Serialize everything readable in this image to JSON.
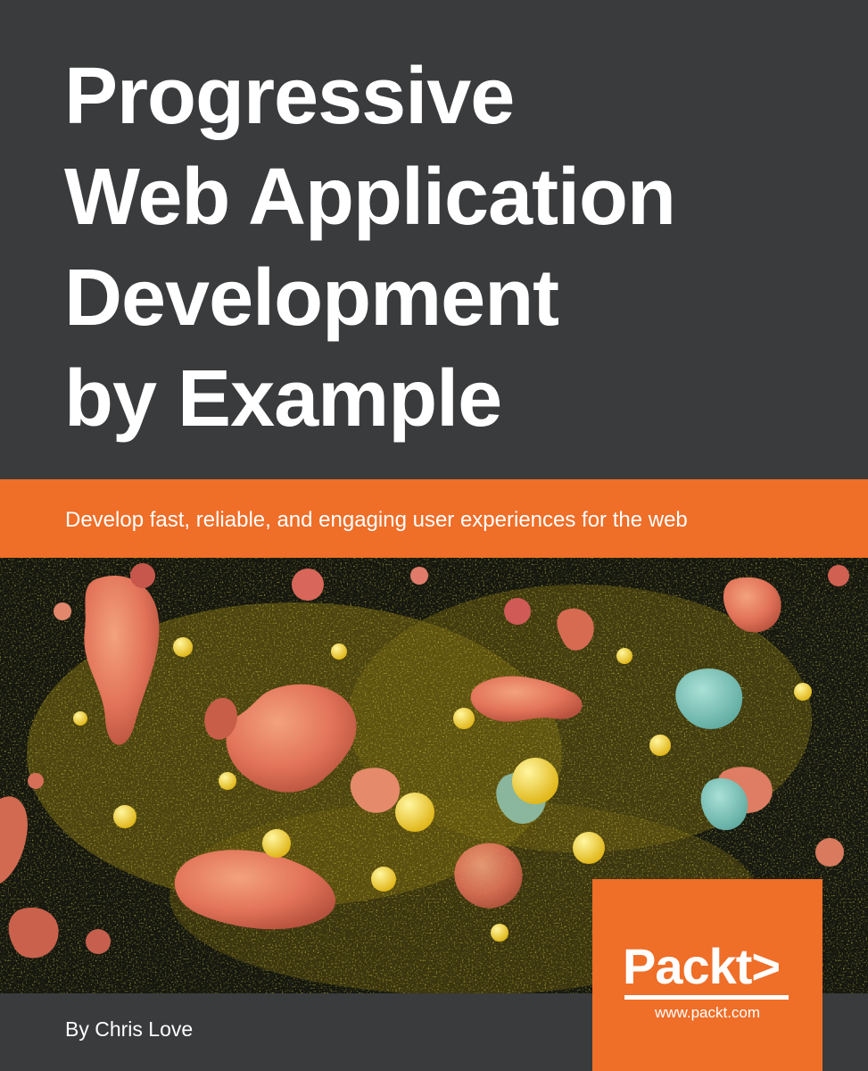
{
  "cover": {
    "title_lines": [
      "Progressive",
      "Web Application",
      "Development",
      "by Example"
    ],
    "subtitle": "Develop fast, reliable, and engaging user experiences for the web",
    "author": "By Chris Love",
    "publisher": {
      "logo_text": "Packt>",
      "url": "www.packt.com"
    }
  },
  "colors": {
    "background": "#3a3b3d",
    "accent": "#ef6e28",
    "text": "#ffffff"
  }
}
